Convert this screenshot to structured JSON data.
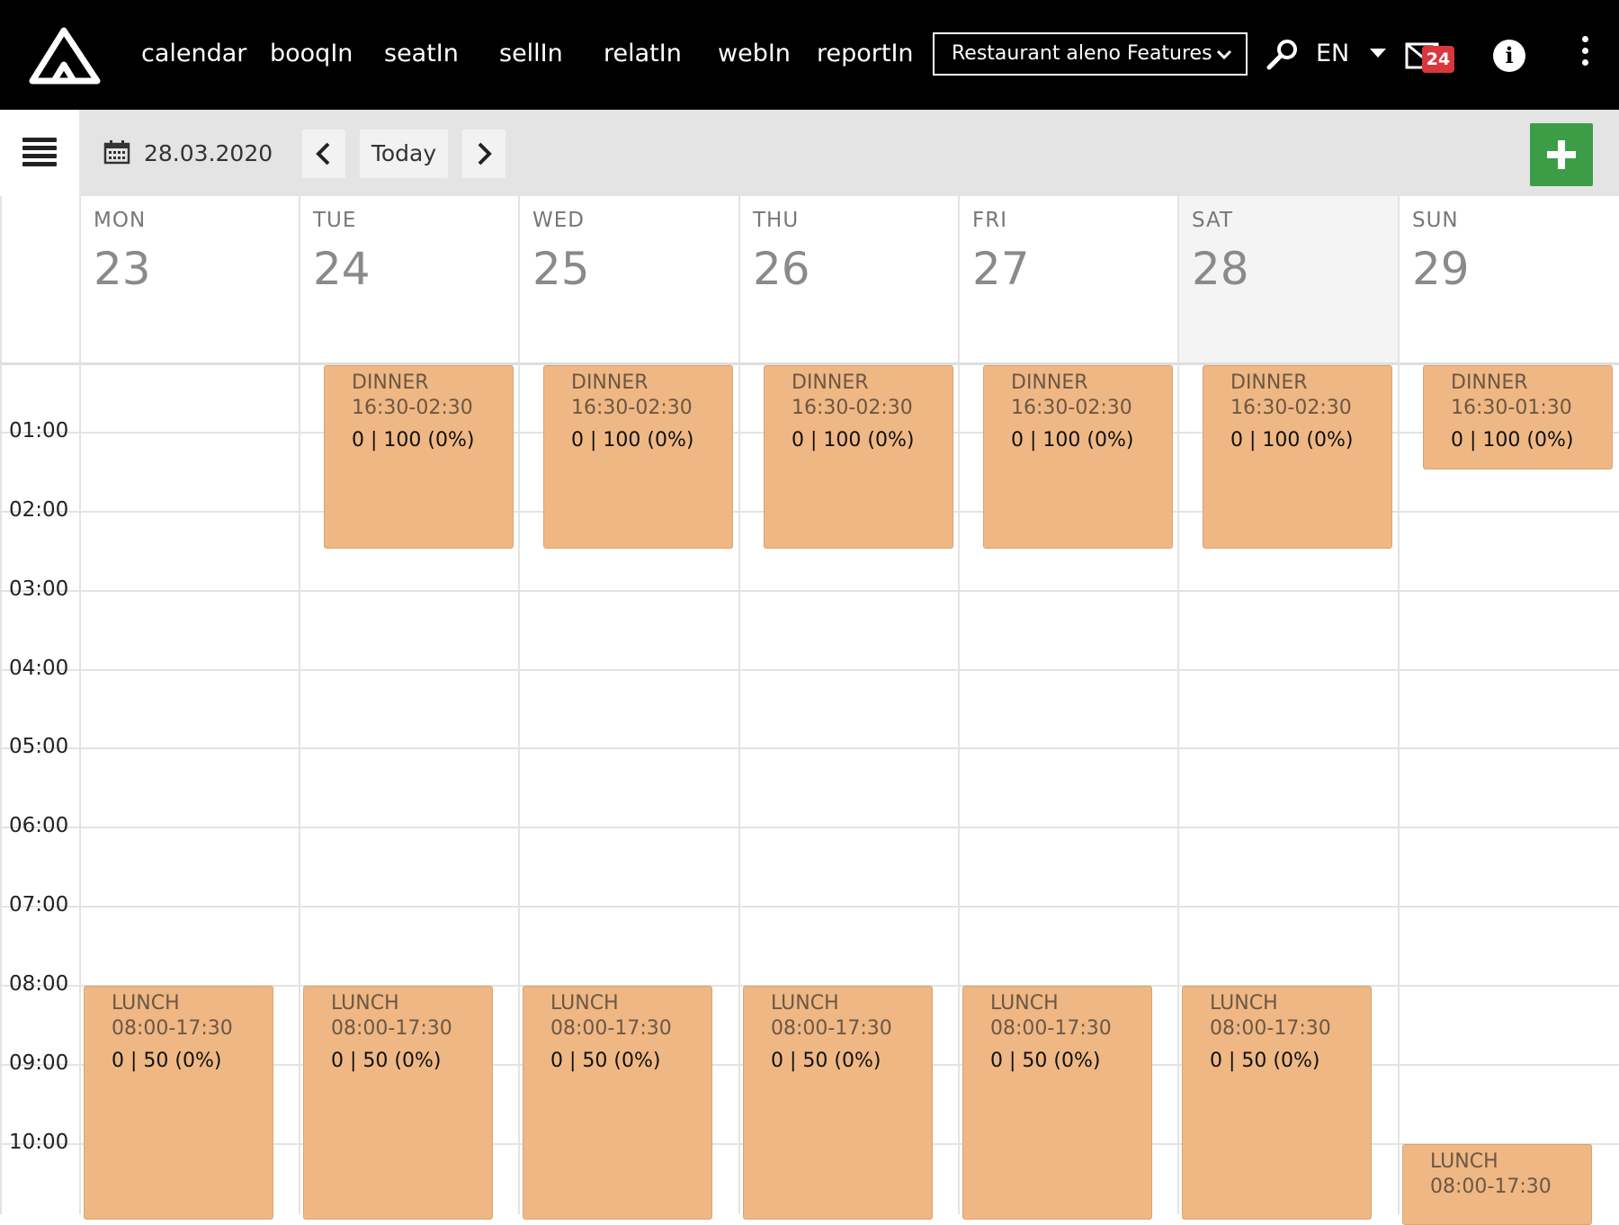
{
  "topbar": {
    "nav": [
      "calendar",
      "booqIn",
      "seatIn",
      "sellIn",
      "relatIn",
      "webIn",
      "reportIn"
    ],
    "restaurant": "Restaurant aleno Features",
    "language": "EN",
    "mail_count": "24",
    "icons": [
      "logo-icon",
      "search-icon",
      "mail-icon",
      "info-icon",
      "kebab-menu-icon"
    ]
  },
  "toolbar": {
    "date": "28.03.2020",
    "today_label": "Today"
  },
  "days": [
    {
      "dow": "MON",
      "num": "23"
    },
    {
      "dow": "TUE",
      "num": "24"
    },
    {
      "dow": "WED",
      "num": "25"
    },
    {
      "dow": "THU",
      "num": "26"
    },
    {
      "dow": "FRI",
      "num": "27"
    },
    {
      "dow": "SAT",
      "num": "28"
    },
    {
      "dow": "SUN",
      "num": "29"
    }
  ],
  "times": [
    "01:00",
    "02:00",
    "03:00",
    "04:00",
    "05:00",
    "06:00",
    "07:00",
    "08:00",
    "09:00",
    "10:00"
  ],
  "events": {
    "dinner": [
      {
        "name": "DINNER",
        "time": "16:30-02:30",
        "occ": "0 | 100 (0%)"
      },
      {
        "name": "DINNER",
        "time": "16:30-02:30",
        "occ": "0 | 100 (0%)"
      },
      {
        "name": "DINNER",
        "time": "16:30-02:30",
        "occ": "0 | 100 (0%)"
      },
      {
        "name": "DINNER",
        "time": "16:30-02:30",
        "occ": "0 | 100 (0%)"
      },
      {
        "name": "DINNER",
        "time": "16:30-02:30",
        "occ": "0 | 100 (0%)"
      },
      {
        "name": "DINNER",
        "time": "16:30-01:30",
        "occ": "0 | 100 (0%)"
      }
    ],
    "lunch": [
      {
        "name": "LUNCH",
        "time": "08:00-17:30",
        "occ": "0 | 50 (0%)"
      },
      {
        "name": "LUNCH",
        "time": "08:00-17:30",
        "occ": "0 | 50 (0%)"
      },
      {
        "name": "LUNCH",
        "time": "08:00-17:30",
        "occ": "0 | 50 (0%)"
      },
      {
        "name": "LUNCH",
        "time": "08:00-17:30",
        "occ": "0 | 50 (0%)"
      },
      {
        "name": "LUNCH",
        "time": "08:00-17:30",
        "occ": "0 | 50 (0%)"
      },
      {
        "name": "LUNCH",
        "time": "08:00-17:30",
        "occ": "0 | 50 (0%)"
      },
      {
        "name": "LUNCH",
        "time": "08:00-17:30"
      }
    ]
  },
  "colors": {
    "topbar": "#000000",
    "event": "#eeb784",
    "add_button": "#3d9d46",
    "badge": "#d9363e"
  }
}
